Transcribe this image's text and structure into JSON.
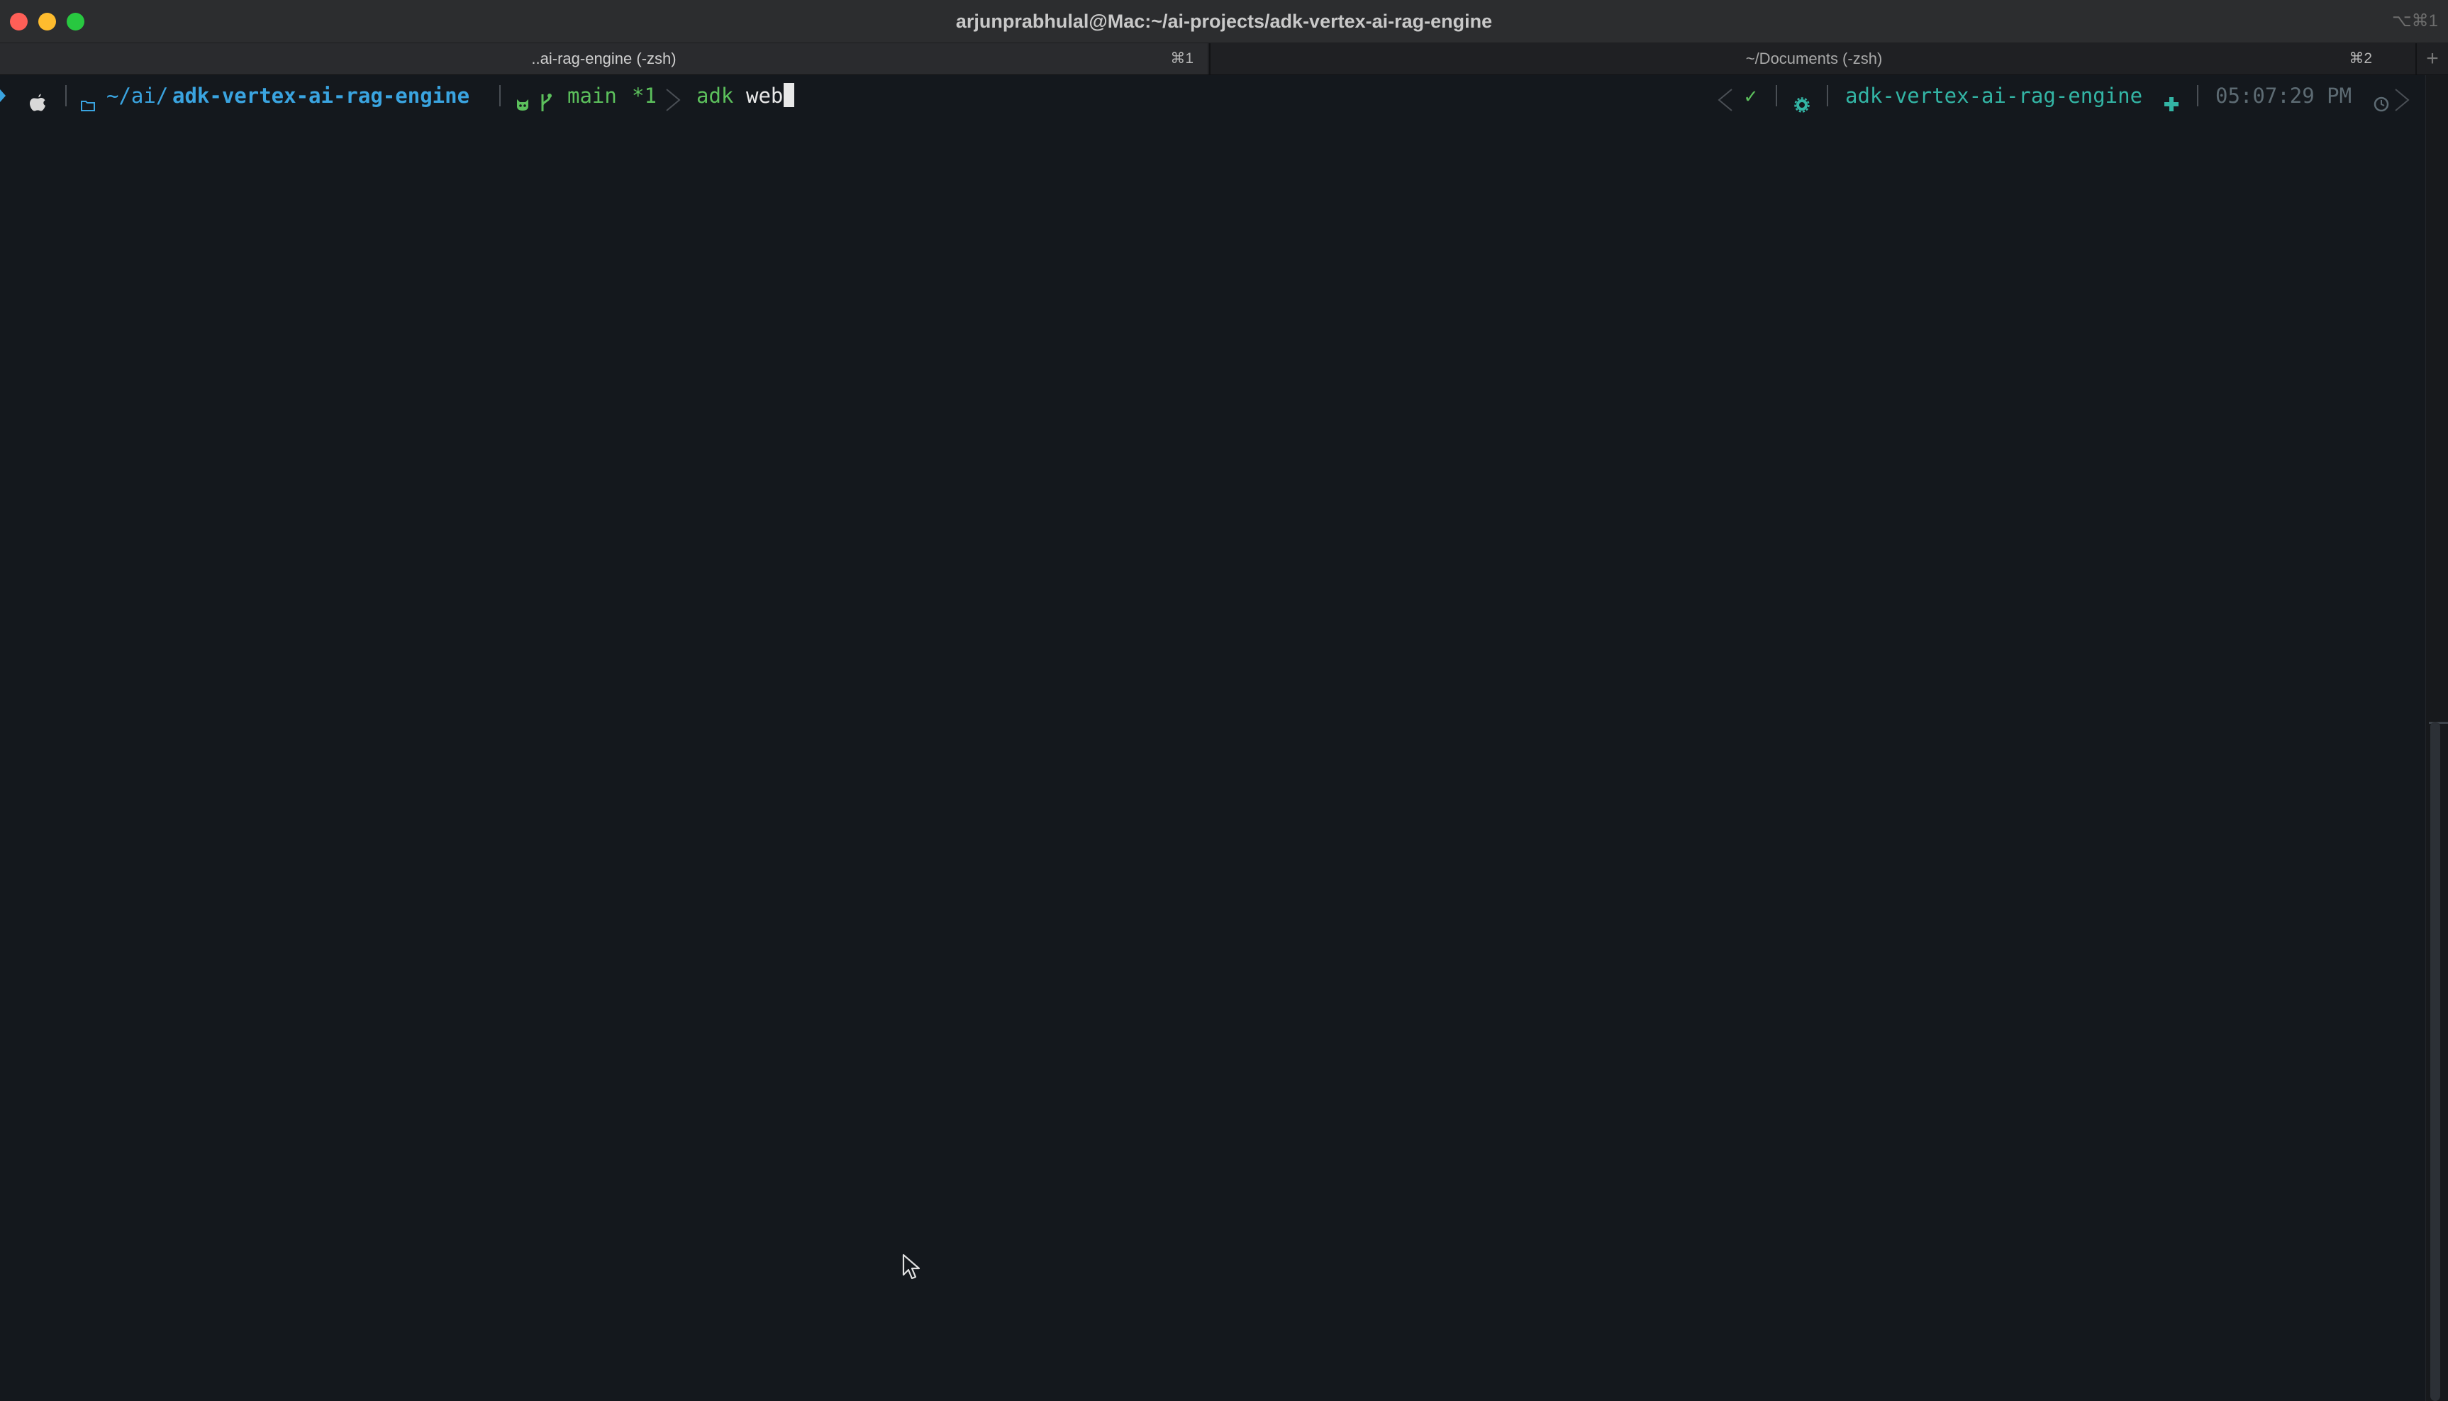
{
  "window": {
    "title": "arjunprabhulal@Mac:~/ai-projects/adk-vertex-ai-rag-engine",
    "title_shortcut": "⌥⌘1"
  },
  "tabs": [
    {
      "label": "..ai-rag-engine (-zsh)",
      "shortcut": "⌘1",
      "active": true
    },
    {
      "label": "~/Documents (-zsh)",
      "shortcut": "⌘2",
      "active": false
    }
  ],
  "new_tab_symbol": "+",
  "prompt": {
    "os_icon": "apple-icon",
    "dir_prefix": "~/ai/",
    "dir_name": "adk-vertex-ai-rag-engine",
    "git_branch": "main",
    "git_status": "*1",
    "command_name": "adk",
    "command_arg": "web",
    "right_status_ok": "✓",
    "right_venv": "adk-vertex-ai-rag-engine",
    "right_time": "05:07:29 PM"
  },
  "colors": {
    "background": "#14181d",
    "dir_blue": "#3aa4e0",
    "git_green": "#5cc05c",
    "command_green": "#5cc05c",
    "teal": "#33b5a5",
    "time_gray": "#5d6b73"
  }
}
